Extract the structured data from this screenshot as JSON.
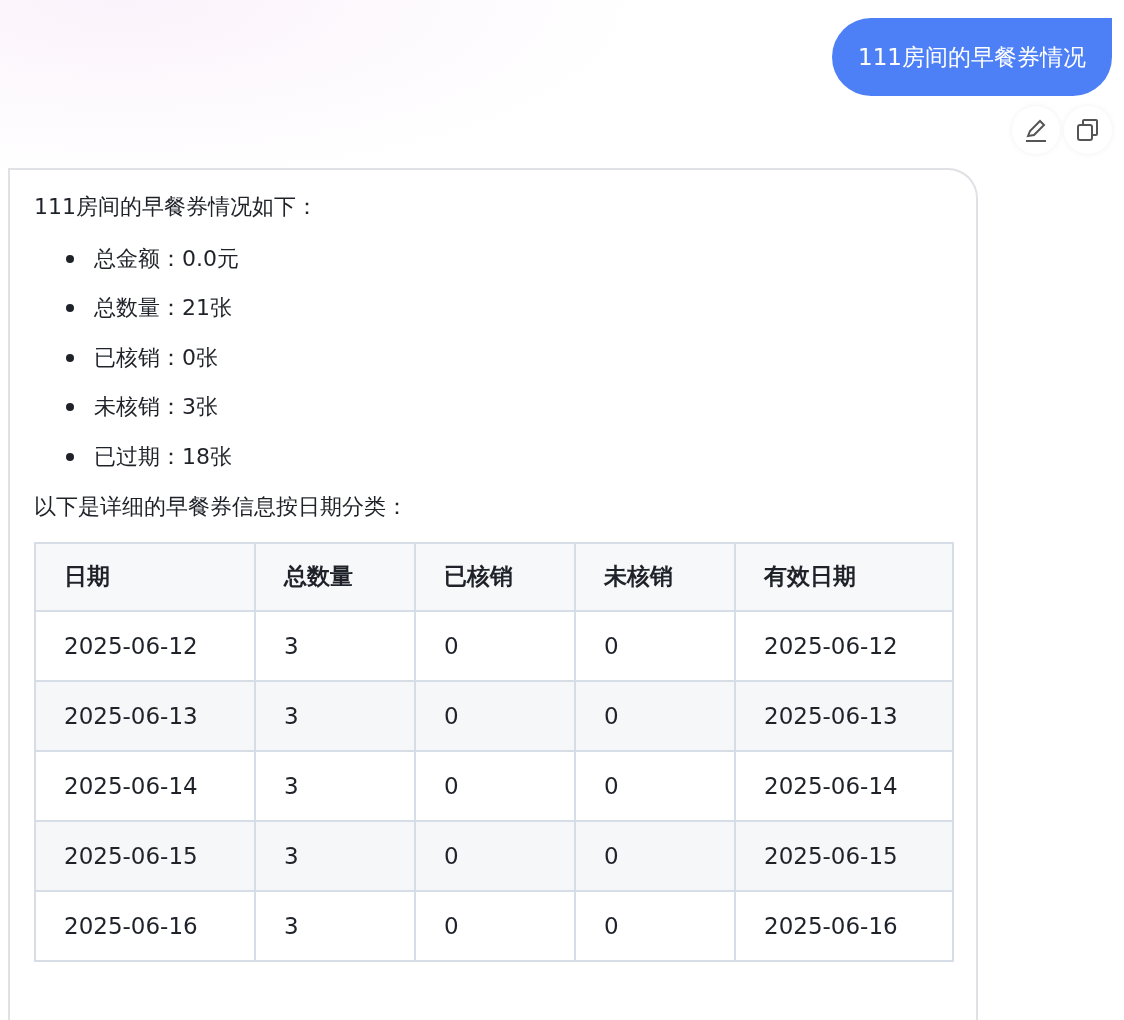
{
  "user_message": {
    "text": "111房间的早餐券情况"
  },
  "message_actions": [
    {
      "kind": "edit"
    },
    {
      "kind": "copy"
    }
  ],
  "reply": {
    "intro": "111房间的早餐券情况如下：",
    "summary": [
      "总金额：0.0元",
      "总数量：21张",
      "已核销：0张",
      "未核销：3张",
      "已过期：18张"
    ],
    "table_intro": "以下是详细的早餐券信息按日期分类：",
    "table": {
      "columns": [
        "日期",
        "总数量",
        "已核销",
        "未核销",
        "有效日期"
      ],
      "rows": [
        [
          "2025-06-12",
          "3",
          "0",
          "0",
          "2025-06-12"
        ],
        [
          "2025-06-13",
          "3",
          "0",
          "0",
          "2025-06-13"
        ],
        [
          "2025-06-14",
          "3",
          "0",
          "0",
          "2025-06-14"
        ],
        [
          "2025-06-15",
          "3",
          "0",
          "0",
          "2025-06-15"
        ],
        [
          "2025-06-16",
          "3",
          "0",
          "0",
          "2025-06-16"
        ]
      ]
    }
  }
}
